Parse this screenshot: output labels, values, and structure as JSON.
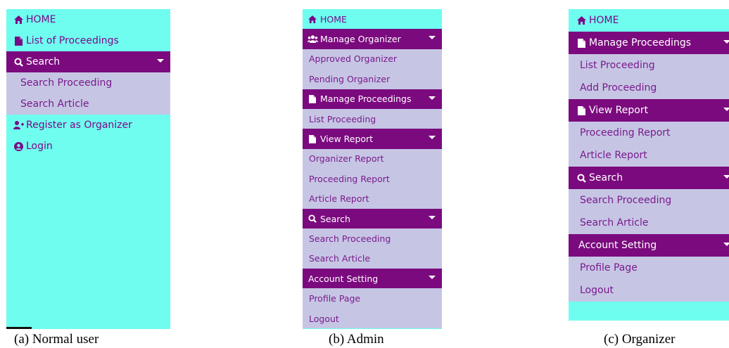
{
  "colors": {
    "panel_bg": "#6ffdf0",
    "header_bg": "#7b0a7e",
    "sub_bg": "#c6c6e4",
    "text": "#7a0a87"
  },
  "panel_a": {
    "home": "HOME",
    "list_proceedings": "List of Proceedings",
    "search": "Search",
    "search_proceeding": "Search Proceeding",
    "search_article": "Search Article",
    "register": "Register as Organizer",
    "login": "Login",
    "caption": "(a) Normal user"
  },
  "panel_b": {
    "home": "HOME",
    "manage_organizer": "Manage Organizer",
    "approved_organizer": "Approved Organizer",
    "pending_organizer": "Pending Organizer",
    "manage_proceedings": "Manage Proceedings",
    "list_proceeding": "List Proceeding",
    "view_report": "View Report",
    "organizer_report": "Organizer Report",
    "proceeding_report": "Proceeding Report",
    "article_report": "Article Report",
    "search": "Search",
    "search_proceeding": "Search Proceeding",
    "search_article": "Search Article",
    "account_setting": "Account Setting",
    "profile_page": "Profile Page",
    "logout": "Logout",
    "caption": "(b) Admin"
  },
  "panel_c": {
    "home": "HOME",
    "manage_proceedings": "Manage Proceedings",
    "list_proceeding": "List Proceeding",
    "add_proceeding": "Add Proceeding",
    "view_report": "View Report",
    "proceeding_report": "Proceeding Report",
    "article_report": "Article Report",
    "search": "Search",
    "search_proceeding": "Search Proceeding",
    "search_article": "Search Article",
    "account_setting": "Account Setting",
    "profile_page": "Profile Page",
    "logout": "Logout",
    "caption": "(c) Organizer"
  }
}
